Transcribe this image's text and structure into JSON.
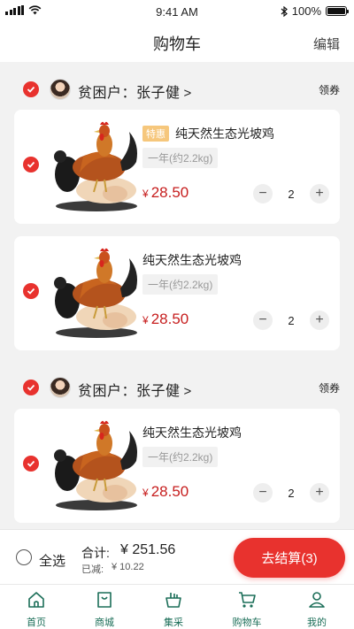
{
  "status_bar": {
    "time": "9:41 AM",
    "battery": "100%"
  },
  "header": {
    "title": "购物车",
    "edit_label": "编辑"
  },
  "shops": [
    {
      "name": "贫困户：张子健",
      "coupon_label": "领券",
      "items": [
        {
          "tag": "特惠",
          "name": "纯天然生态光坡鸡",
          "spec": "一年(约2.2kg)",
          "currency": "¥",
          "price": "28.50",
          "qty": "2"
        },
        {
          "name": "纯天然生态光坡鸡",
          "spec": "一年(约2.2kg)",
          "currency": "¥",
          "price": "28.50",
          "qty": "2"
        }
      ]
    },
    {
      "name": "贫困户：张子健",
      "coupon_label": "领券",
      "items": [
        {
          "name": "纯天然生态光坡鸡",
          "spec": "一年(约2.2kg)",
          "currency": "¥",
          "price": "28.50",
          "qty": "2"
        }
      ]
    }
  ],
  "stepper": {
    "minus": "−",
    "plus": "+"
  },
  "footer": {
    "select_all": "全选",
    "total_label": "合计:",
    "total_value": "¥ 251.56",
    "saved_label": "已减:",
    "saved_value": "¥ 10.22",
    "checkout": "去结算(3)"
  },
  "tabs": [
    {
      "label": "首页",
      "icon": "home-icon"
    },
    {
      "label": "商城",
      "icon": "shopping-bag-icon"
    },
    {
      "label": "集采",
      "icon": "basket-icon"
    },
    {
      "label": "购物车",
      "icon": "cart-icon"
    },
    {
      "label": "我的",
      "icon": "user-icon"
    }
  ],
  "colors": {
    "accent": "#e8322e",
    "price": "#c61d1d",
    "tab": "#1b6e58",
    "tag": "#f6c77c"
  }
}
